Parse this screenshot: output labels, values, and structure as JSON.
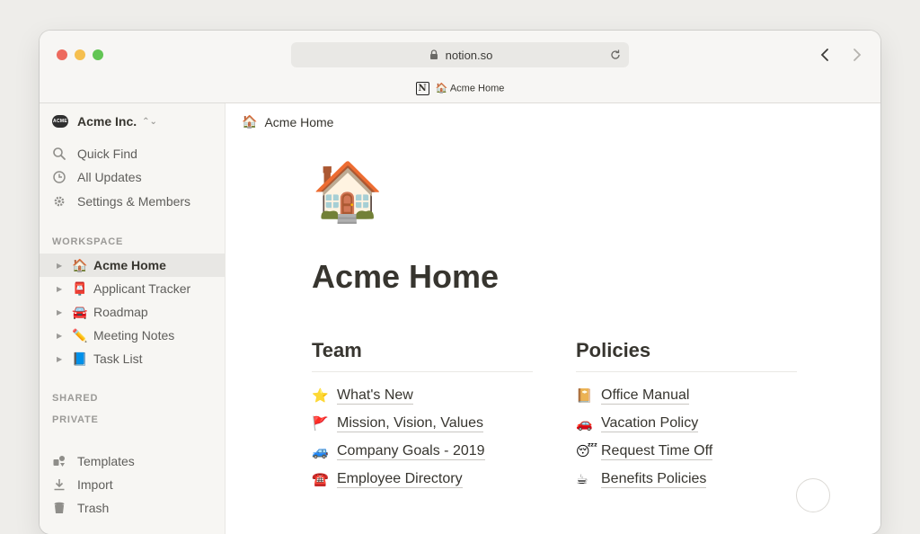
{
  "browser": {
    "url": "notion.so",
    "tab_title": "Acme Home",
    "tab_emoji": "🏠"
  },
  "sidebar": {
    "workspace_name": "Acme Inc.",
    "workspace_logo_text": "ACME",
    "top_items": [
      {
        "label": "Quick Find",
        "icon": "search-icon"
      },
      {
        "label": "All Updates",
        "icon": "clock-icon"
      },
      {
        "label": "Settings & Members",
        "icon": "gear-icon"
      }
    ],
    "workspace_label": "WORKSPACE",
    "pages": [
      {
        "emoji": "🏠",
        "label": "Acme Home",
        "active": true
      },
      {
        "emoji": "📮",
        "label": "Applicant Tracker"
      },
      {
        "emoji": "🚘",
        "label": "Roadmap"
      },
      {
        "emoji": "✏️",
        "label": "Meeting Notes"
      },
      {
        "emoji": "📘",
        "label": "Task List"
      }
    ],
    "shared_label": "SHARED",
    "private_label": "PRIVATE",
    "bottom_items": [
      {
        "label": "Templates",
        "icon": "templates-icon"
      },
      {
        "label": "Import",
        "icon": "import-icon"
      },
      {
        "label": "Trash",
        "icon": "trash-icon"
      }
    ]
  },
  "page": {
    "breadcrumb_emoji": "🏠",
    "breadcrumb": "Acme Home",
    "icon": "🏠",
    "title": "Acme Home",
    "team": {
      "heading": "Team",
      "links": [
        {
          "emoji": "⭐",
          "label": "What's New"
        },
        {
          "emoji": "🚩",
          "label": "Mission, Vision, Values"
        },
        {
          "emoji": "🚙",
          "label": "Company Goals - 2019"
        },
        {
          "emoji": "☎️",
          "label": "Employee Directory"
        }
      ]
    },
    "policies": {
      "heading": "Policies",
      "links": [
        {
          "emoji": "📔",
          "label": "Office Manual"
        },
        {
          "emoji": "🚗",
          "label": "Vacation Policy"
        },
        {
          "emoji": "😴",
          "label": "Request Time Off"
        },
        {
          "emoji": "☕",
          "label": "Benefits Policies"
        }
      ]
    }
  }
}
